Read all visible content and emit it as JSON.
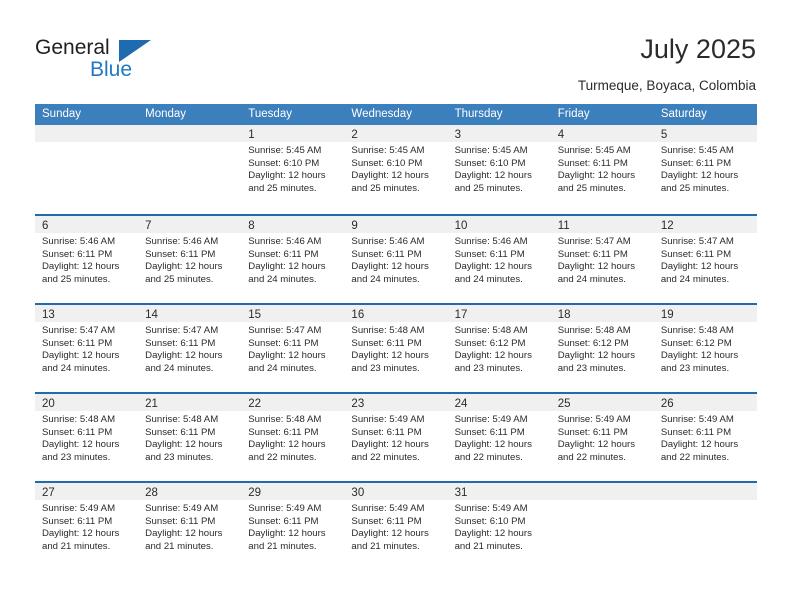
{
  "brand": {
    "name_part1": "General",
    "name_part2": "Blue",
    "flag_icon": "triangle-flag-icon",
    "color_primary": "#2079c4",
    "color_dark": "#231f20"
  },
  "header": {
    "title": "July 2025",
    "subtitle": "Turmeque, Boyaca, Colombia"
  },
  "theme": {
    "header_row_bg": "#3c7fbd",
    "row_divider": "#1f6bb0",
    "day_band_bg": "#f0f0f0",
    "text": "#2b2b2b"
  },
  "calendar": {
    "weekdays": [
      "Sunday",
      "Monday",
      "Tuesday",
      "Wednesday",
      "Thursday",
      "Friday",
      "Saturday"
    ],
    "weeks": [
      [
        {
          "day": "",
          "sunrise": "",
          "sunset": "",
          "daylight_1": "",
          "daylight_2": ""
        },
        {
          "day": "",
          "sunrise": "",
          "sunset": "",
          "daylight_1": "",
          "daylight_2": ""
        },
        {
          "day": "1",
          "sunrise": "Sunrise: 5:45 AM",
          "sunset": "Sunset: 6:10 PM",
          "daylight_1": "Daylight: 12 hours",
          "daylight_2": "and 25 minutes."
        },
        {
          "day": "2",
          "sunrise": "Sunrise: 5:45 AM",
          "sunset": "Sunset: 6:10 PM",
          "daylight_1": "Daylight: 12 hours",
          "daylight_2": "and 25 minutes."
        },
        {
          "day": "3",
          "sunrise": "Sunrise: 5:45 AM",
          "sunset": "Sunset: 6:10 PM",
          "daylight_1": "Daylight: 12 hours",
          "daylight_2": "and 25 minutes."
        },
        {
          "day": "4",
          "sunrise": "Sunrise: 5:45 AM",
          "sunset": "Sunset: 6:11 PM",
          "daylight_1": "Daylight: 12 hours",
          "daylight_2": "and 25 minutes."
        },
        {
          "day": "5",
          "sunrise": "Sunrise: 5:45 AM",
          "sunset": "Sunset: 6:11 PM",
          "daylight_1": "Daylight: 12 hours",
          "daylight_2": "and 25 minutes."
        }
      ],
      [
        {
          "day": "6",
          "sunrise": "Sunrise: 5:46 AM",
          "sunset": "Sunset: 6:11 PM",
          "daylight_1": "Daylight: 12 hours",
          "daylight_2": "and 25 minutes."
        },
        {
          "day": "7",
          "sunrise": "Sunrise: 5:46 AM",
          "sunset": "Sunset: 6:11 PM",
          "daylight_1": "Daylight: 12 hours",
          "daylight_2": "and 25 minutes."
        },
        {
          "day": "8",
          "sunrise": "Sunrise: 5:46 AM",
          "sunset": "Sunset: 6:11 PM",
          "daylight_1": "Daylight: 12 hours",
          "daylight_2": "and 24 minutes."
        },
        {
          "day": "9",
          "sunrise": "Sunrise: 5:46 AM",
          "sunset": "Sunset: 6:11 PM",
          "daylight_1": "Daylight: 12 hours",
          "daylight_2": "and 24 minutes."
        },
        {
          "day": "10",
          "sunrise": "Sunrise: 5:46 AM",
          "sunset": "Sunset: 6:11 PM",
          "daylight_1": "Daylight: 12 hours",
          "daylight_2": "and 24 minutes."
        },
        {
          "day": "11",
          "sunrise": "Sunrise: 5:47 AM",
          "sunset": "Sunset: 6:11 PM",
          "daylight_1": "Daylight: 12 hours",
          "daylight_2": "and 24 minutes."
        },
        {
          "day": "12",
          "sunrise": "Sunrise: 5:47 AM",
          "sunset": "Sunset: 6:11 PM",
          "daylight_1": "Daylight: 12 hours",
          "daylight_2": "and 24 minutes."
        }
      ],
      [
        {
          "day": "13",
          "sunrise": "Sunrise: 5:47 AM",
          "sunset": "Sunset: 6:11 PM",
          "daylight_1": "Daylight: 12 hours",
          "daylight_2": "and 24 minutes."
        },
        {
          "day": "14",
          "sunrise": "Sunrise: 5:47 AM",
          "sunset": "Sunset: 6:11 PM",
          "daylight_1": "Daylight: 12 hours",
          "daylight_2": "and 24 minutes."
        },
        {
          "day": "15",
          "sunrise": "Sunrise: 5:47 AM",
          "sunset": "Sunset: 6:11 PM",
          "daylight_1": "Daylight: 12 hours",
          "daylight_2": "and 24 minutes."
        },
        {
          "day": "16",
          "sunrise": "Sunrise: 5:48 AM",
          "sunset": "Sunset: 6:11 PM",
          "daylight_1": "Daylight: 12 hours",
          "daylight_2": "and 23 minutes."
        },
        {
          "day": "17",
          "sunrise": "Sunrise: 5:48 AM",
          "sunset": "Sunset: 6:12 PM",
          "daylight_1": "Daylight: 12 hours",
          "daylight_2": "and 23 minutes."
        },
        {
          "day": "18",
          "sunrise": "Sunrise: 5:48 AM",
          "sunset": "Sunset: 6:12 PM",
          "daylight_1": "Daylight: 12 hours",
          "daylight_2": "and 23 minutes."
        },
        {
          "day": "19",
          "sunrise": "Sunrise: 5:48 AM",
          "sunset": "Sunset: 6:12 PM",
          "daylight_1": "Daylight: 12 hours",
          "daylight_2": "and 23 minutes."
        }
      ],
      [
        {
          "day": "20",
          "sunrise": "Sunrise: 5:48 AM",
          "sunset": "Sunset: 6:11 PM",
          "daylight_1": "Daylight: 12 hours",
          "daylight_2": "and 23 minutes."
        },
        {
          "day": "21",
          "sunrise": "Sunrise: 5:48 AM",
          "sunset": "Sunset: 6:11 PM",
          "daylight_1": "Daylight: 12 hours",
          "daylight_2": "and 23 minutes."
        },
        {
          "day": "22",
          "sunrise": "Sunrise: 5:48 AM",
          "sunset": "Sunset: 6:11 PM",
          "daylight_1": "Daylight: 12 hours",
          "daylight_2": "and 22 minutes."
        },
        {
          "day": "23",
          "sunrise": "Sunrise: 5:49 AM",
          "sunset": "Sunset: 6:11 PM",
          "daylight_1": "Daylight: 12 hours",
          "daylight_2": "and 22 minutes."
        },
        {
          "day": "24",
          "sunrise": "Sunrise: 5:49 AM",
          "sunset": "Sunset: 6:11 PM",
          "daylight_1": "Daylight: 12 hours",
          "daylight_2": "and 22 minutes."
        },
        {
          "day": "25",
          "sunrise": "Sunrise: 5:49 AM",
          "sunset": "Sunset: 6:11 PM",
          "daylight_1": "Daylight: 12 hours",
          "daylight_2": "and 22 minutes."
        },
        {
          "day": "26",
          "sunrise": "Sunrise: 5:49 AM",
          "sunset": "Sunset: 6:11 PM",
          "daylight_1": "Daylight: 12 hours",
          "daylight_2": "and 22 minutes."
        }
      ],
      [
        {
          "day": "27",
          "sunrise": "Sunrise: 5:49 AM",
          "sunset": "Sunset: 6:11 PM",
          "daylight_1": "Daylight: 12 hours",
          "daylight_2": "and 21 minutes."
        },
        {
          "day": "28",
          "sunrise": "Sunrise: 5:49 AM",
          "sunset": "Sunset: 6:11 PM",
          "daylight_1": "Daylight: 12 hours",
          "daylight_2": "and 21 minutes."
        },
        {
          "day": "29",
          "sunrise": "Sunrise: 5:49 AM",
          "sunset": "Sunset: 6:11 PM",
          "daylight_1": "Daylight: 12 hours",
          "daylight_2": "and 21 minutes."
        },
        {
          "day": "30",
          "sunrise": "Sunrise: 5:49 AM",
          "sunset": "Sunset: 6:11 PM",
          "daylight_1": "Daylight: 12 hours",
          "daylight_2": "and 21 minutes."
        },
        {
          "day": "31",
          "sunrise": "Sunrise: 5:49 AM",
          "sunset": "Sunset: 6:10 PM",
          "daylight_1": "Daylight: 12 hours",
          "daylight_2": "and 21 minutes."
        },
        {
          "day": "",
          "sunrise": "",
          "sunset": "",
          "daylight_1": "",
          "daylight_2": ""
        },
        {
          "day": "",
          "sunrise": "",
          "sunset": "",
          "daylight_1": "",
          "daylight_2": ""
        }
      ]
    ]
  }
}
